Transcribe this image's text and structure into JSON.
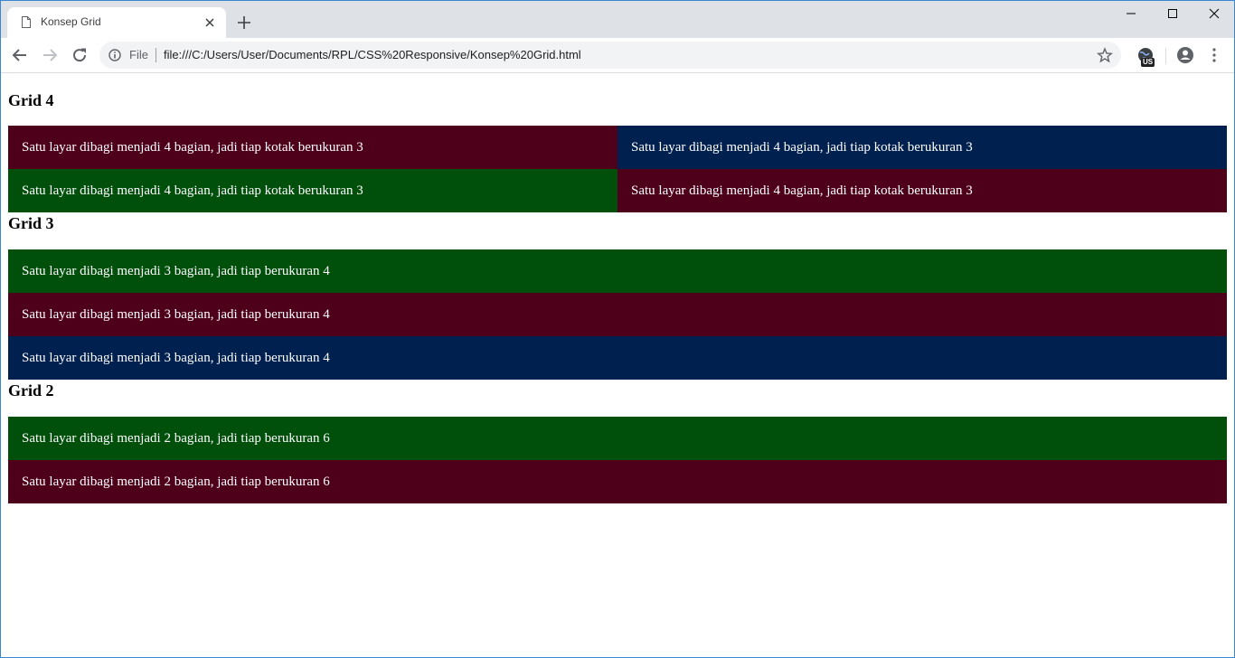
{
  "browser": {
    "tab_title": "Konsep Grid",
    "scheme_label": "File",
    "url": "file:///C:/Users/User/Documents/RPL/CSS%20Responsive/Konsep%20Grid.html",
    "extension_badge": "US"
  },
  "colors": {
    "maroon": "#4e001b",
    "navy": "#002050",
    "green": "#004f0b"
  },
  "page": {
    "grid4": {
      "heading": "Grid 4",
      "cells": [
        "Satu layar dibagi menjadi 4 bagian, jadi tiap kotak berukuran 3",
        "Satu layar dibagi menjadi 4 bagian, jadi tiap kotak berukuran 3",
        "Satu layar dibagi menjadi 4 bagian, jadi tiap kotak berukuran 3",
        "Satu layar dibagi menjadi 4 bagian, jadi tiap kotak berukuran 3"
      ]
    },
    "grid3": {
      "heading": "Grid 3",
      "cells": [
        "Satu layar dibagi menjadi 3 bagian, jadi tiap berukuran 4",
        "Satu layar dibagi menjadi 3 bagian, jadi tiap berukuran 4",
        "Satu layar dibagi menjadi 3 bagian, jadi tiap berukuran 4"
      ]
    },
    "grid2": {
      "heading": "Grid 2",
      "cells": [
        "Satu layar dibagi menjadi 2 bagian, jadi tiap berukuran 6",
        "Satu layar dibagi menjadi 2 bagian, jadi tiap berukuran 6"
      ]
    }
  }
}
